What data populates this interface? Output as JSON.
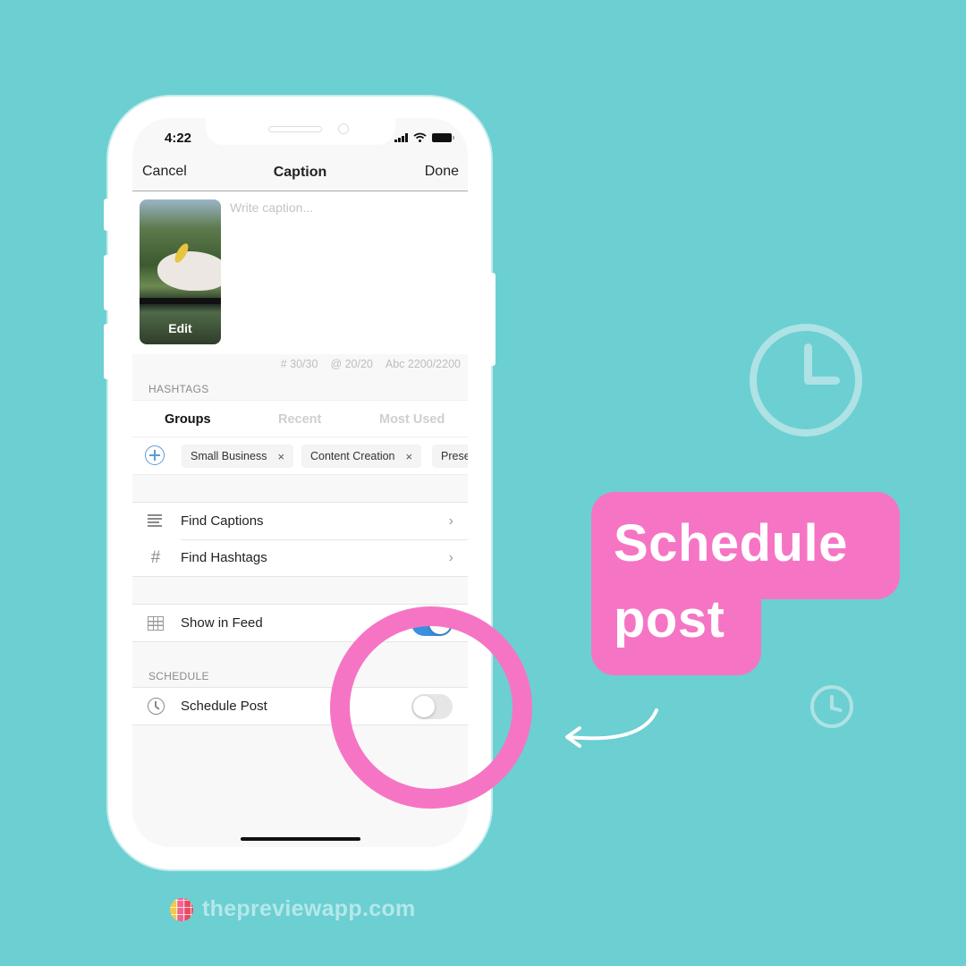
{
  "status_bar": {
    "time": "4:22"
  },
  "navbar": {
    "cancel": "Cancel",
    "title": "Caption",
    "done": "Done"
  },
  "caption": {
    "placeholder": "Write caption...",
    "thumbnail_action": "Edit"
  },
  "counters": {
    "hashtags": "# 30/30",
    "mentions": "@ 20/20",
    "characters": "Abc 2200/2200"
  },
  "hashtags": {
    "section_label": "HASHTAGS",
    "tabs": [
      {
        "label": "Groups",
        "active": true
      },
      {
        "label": "Recent",
        "active": false
      },
      {
        "label": "Most Used",
        "active": false
      }
    ],
    "chips": [
      {
        "label": "Small Business",
        "remove": "×"
      },
      {
        "label": "Content Creation",
        "remove": "×"
      },
      {
        "label": "Prese",
        "remove": ""
      }
    ]
  },
  "tools": [
    {
      "label": "Find Captions",
      "icon": "lines-icon"
    },
    {
      "label": "Find Hashtags",
      "icon": "hash-icon",
      "glyph": "#"
    }
  ],
  "feed": {
    "label": "Show in Feed",
    "enabled": true
  },
  "schedule": {
    "section_label": "SCHEDULE",
    "label": "Schedule Post",
    "enabled": false
  },
  "callout": {
    "line1": "Schedule",
    "line2": "post"
  },
  "brand": {
    "text": "thepreviewapp.com"
  },
  "colors": {
    "background": "#6ccfd2",
    "accent_pink": "#f575c4",
    "toggle_on": "#3b8fe0",
    "brand_text": "#b4e8ea"
  }
}
